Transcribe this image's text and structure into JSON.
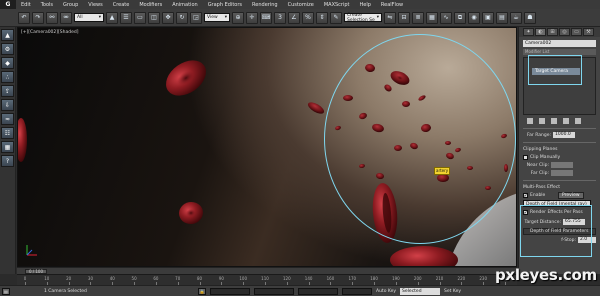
{
  "app": {
    "logo": "G"
  },
  "menu": [
    "Edit",
    "Tools",
    "Group",
    "Views",
    "Create",
    "Modifiers",
    "Animation",
    "Graph Editors",
    "Rendering",
    "Customize",
    "MAXScript",
    "Help",
    "RealFlow"
  ],
  "toolbar": {
    "selection_filter": "All",
    "ref_coord": "View",
    "named_selection": "Create Selection Se"
  },
  "viewport": {
    "label": "[+][Camera002][Shaded]",
    "object_tag": "artery"
  },
  "command_panel": {
    "object_name": "Camera002",
    "modifier_list": "Modifier List",
    "stack_item": "Target Camera",
    "far_range_label": "Far Range:",
    "far_range_value": "1000.0",
    "clipping_title": "Clipping Planes",
    "clip_manually": "Clip Manually",
    "near_clip_label": "Near Clip:",
    "far_clip_label": "Far Clip:",
    "multipass_title": "Multi-Pass Effect",
    "enable_label": "Enable",
    "preview_label": "Preview",
    "effect_type": "Depth of Field (mental ray)",
    "render_per_pass": "Render Effects Per Pass",
    "target_distance_label": "Target Distance:",
    "target_distance_value": "65.755",
    "dof_rollout": "Depth of Field Parameters",
    "fstop_label": "f-Stop:",
    "fstop_value": "2.0"
  },
  "timeline": {
    "thumb": "0 / 100",
    "ticks": [
      "0",
      "10",
      "20",
      "30",
      "40",
      "50",
      "60",
      "70",
      "80",
      "90",
      "100",
      "110",
      "120",
      "140",
      "160",
      "170",
      "180",
      "190",
      "200",
      "210",
      "220",
      "230",
      "240"
    ]
  },
  "status": {
    "text": "1 Camera Selected",
    "autokey": "Auto Key",
    "selected": "Selected",
    "setkey": "Set Key"
  },
  "watermark": "pxleyes.com",
  "colors": {
    "annotation": "#7fd6ee",
    "cell": "#8a1a1f",
    "tag": "#f2d22f"
  }
}
